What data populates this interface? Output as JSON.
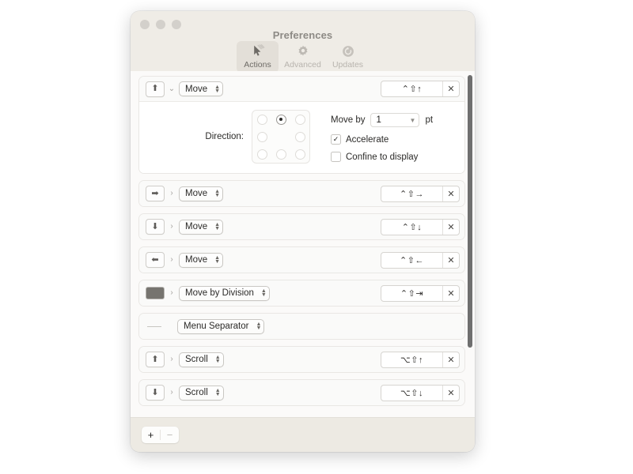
{
  "window": {
    "title": "Preferences",
    "traffic_lights": [
      "close",
      "minimize",
      "zoom"
    ]
  },
  "toolbar": {
    "items": [
      {
        "label": "Actions",
        "icon": "cursor-arrow-icon",
        "selected": true
      },
      {
        "label": "Advanced",
        "icon": "gear-icon",
        "selected": false
      },
      {
        "label": "Updates",
        "icon": "refresh-circle-icon",
        "selected": false
      }
    ]
  },
  "rows": [
    {
      "icon": "arrow-up-icon",
      "icon_glyph": "⬆",
      "icon_kind": "button",
      "disclosure": "chevron-down-icon",
      "disclosure_glyph": "⌄",
      "action": "Move",
      "shortcut": "⌃⇧↑",
      "clear_glyph": "✕",
      "expanded": true
    },
    {
      "icon": "arrow-right-icon",
      "icon_glyph": "➡",
      "icon_kind": "button",
      "disclosure": "chevron-right-icon",
      "disclosure_glyph": "›",
      "action": "Move",
      "shortcut": "⌃⇧→",
      "clear_glyph": "✕",
      "expanded": false
    },
    {
      "icon": "arrow-down-icon",
      "icon_glyph": "⬇",
      "icon_kind": "button",
      "disclosure": "chevron-right-icon",
      "disclosure_glyph": "›",
      "action": "Move",
      "shortcut": "⌃⇧↓",
      "clear_glyph": "✕",
      "expanded": false
    },
    {
      "icon": "arrow-left-icon",
      "icon_glyph": "⬅",
      "icon_kind": "button",
      "disclosure": "chevron-right-icon",
      "disclosure_glyph": "›",
      "action": "Move",
      "shortcut": "⌃⇧←",
      "clear_glyph": "✕",
      "expanded": false
    },
    {
      "icon": "filled-rectangle-icon",
      "icon_glyph": "",
      "icon_kind": "block",
      "disclosure": "chevron-right-icon",
      "disclosure_glyph": "›",
      "action": "Move by Division",
      "shortcut": "⌃⇧⇥",
      "clear_glyph": "✕",
      "expanded": false
    },
    {
      "icon": "horizontal-line-icon",
      "icon_glyph": "",
      "icon_kind": "separator",
      "disclosure": "none",
      "disclosure_glyph": "",
      "action": "Menu Separator",
      "shortcut": "",
      "clear_glyph": "",
      "expanded": false
    },
    {
      "icon": "arrow-up-icon",
      "icon_glyph": "⬆",
      "icon_kind": "button",
      "disclosure": "chevron-right-icon",
      "disclosure_glyph": "›",
      "action": "Scroll",
      "shortcut": "⌥⇧↑",
      "clear_glyph": "✕",
      "expanded": false
    },
    {
      "icon": "arrow-down-icon",
      "icon_glyph": "⬇",
      "icon_kind": "button",
      "disclosure": "chevron-right-icon",
      "disclosure_glyph": "›",
      "action": "Scroll",
      "shortcut": "⌥⇧↓",
      "clear_glyph": "✕",
      "expanded": false
    }
  ],
  "detail": {
    "direction_label": "Direction:",
    "direction_cells": [
      {
        "name": "up-left",
        "selected": false,
        "present": true
      },
      {
        "name": "up",
        "selected": true,
        "present": true
      },
      {
        "name": "up-right",
        "selected": false,
        "present": true
      },
      {
        "name": "left",
        "selected": false,
        "present": true
      },
      {
        "name": "center",
        "selected": false,
        "present": false
      },
      {
        "name": "right",
        "selected": false,
        "present": true
      },
      {
        "name": "down-left",
        "selected": false,
        "present": true
      },
      {
        "name": "down",
        "selected": false,
        "present": true
      },
      {
        "name": "down-right",
        "selected": false,
        "present": true
      }
    ],
    "move_by_label": "Move by",
    "move_by_value": "1",
    "move_by_unit": "pt",
    "accelerate_label": "Accelerate",
    "accelerate_checked": true,
    "accelerate_mark": "✓",
    "confine_label": "Confine to display",
    "confine_checked": false,
    "confine_mark": ""
  },
  "bottom_bar": {
    "add_label": "+",
    "remove_label": "−",
    "remove_enabled": false
  },
  "colors": {
    "window_chrome": "#efece6",
    "content_bg": "#fbfaf9",
    "bottom_bar": "#edeae3",
    "selected_tab": "#e3dfd8",
    "scrollbar_thumb": "#6f6f6f"
  }
}
